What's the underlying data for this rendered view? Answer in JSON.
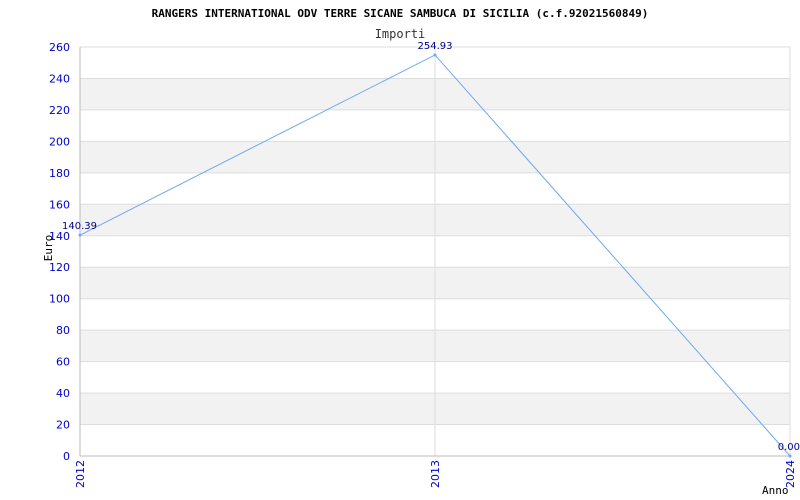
{
  "chart_data": {
    "type": "line",
    "title": "RANGERS INTERNATIONAL ODV TERRE SICANE SAMBUCA DI SICILIA (c.f.92021560849)",
    "subtitle": "Importi",
    "xlabel": "Anno",
    "ylabel": "Euro",
    "categories": [
      "2012",
      "2013",
      "2024"
    ],
    "series": [
      {
        "values": [
          140.39,
          254.93,
          0.0
        ],
        "labels": [
          "140.39",
          "254.93",
          "0.00"
        ]
      }
    ],
    "ylim": [
      0,
      260
    ],
    "yticks": [
      "0",
      "20",
      "40",
      "60",
      "80",
      "100",
      "120",
      "140",
      "160",
      "180",
      "200",
      "220",
      "240",
      "260"
    ],
    "grid": true,
    "colors": {
      "line": "#6fa8f0",
      "band": "#f2f2f2",
      "tick_text": "#0000cc",
      "data_label": "#000080"
    }
  }
}
